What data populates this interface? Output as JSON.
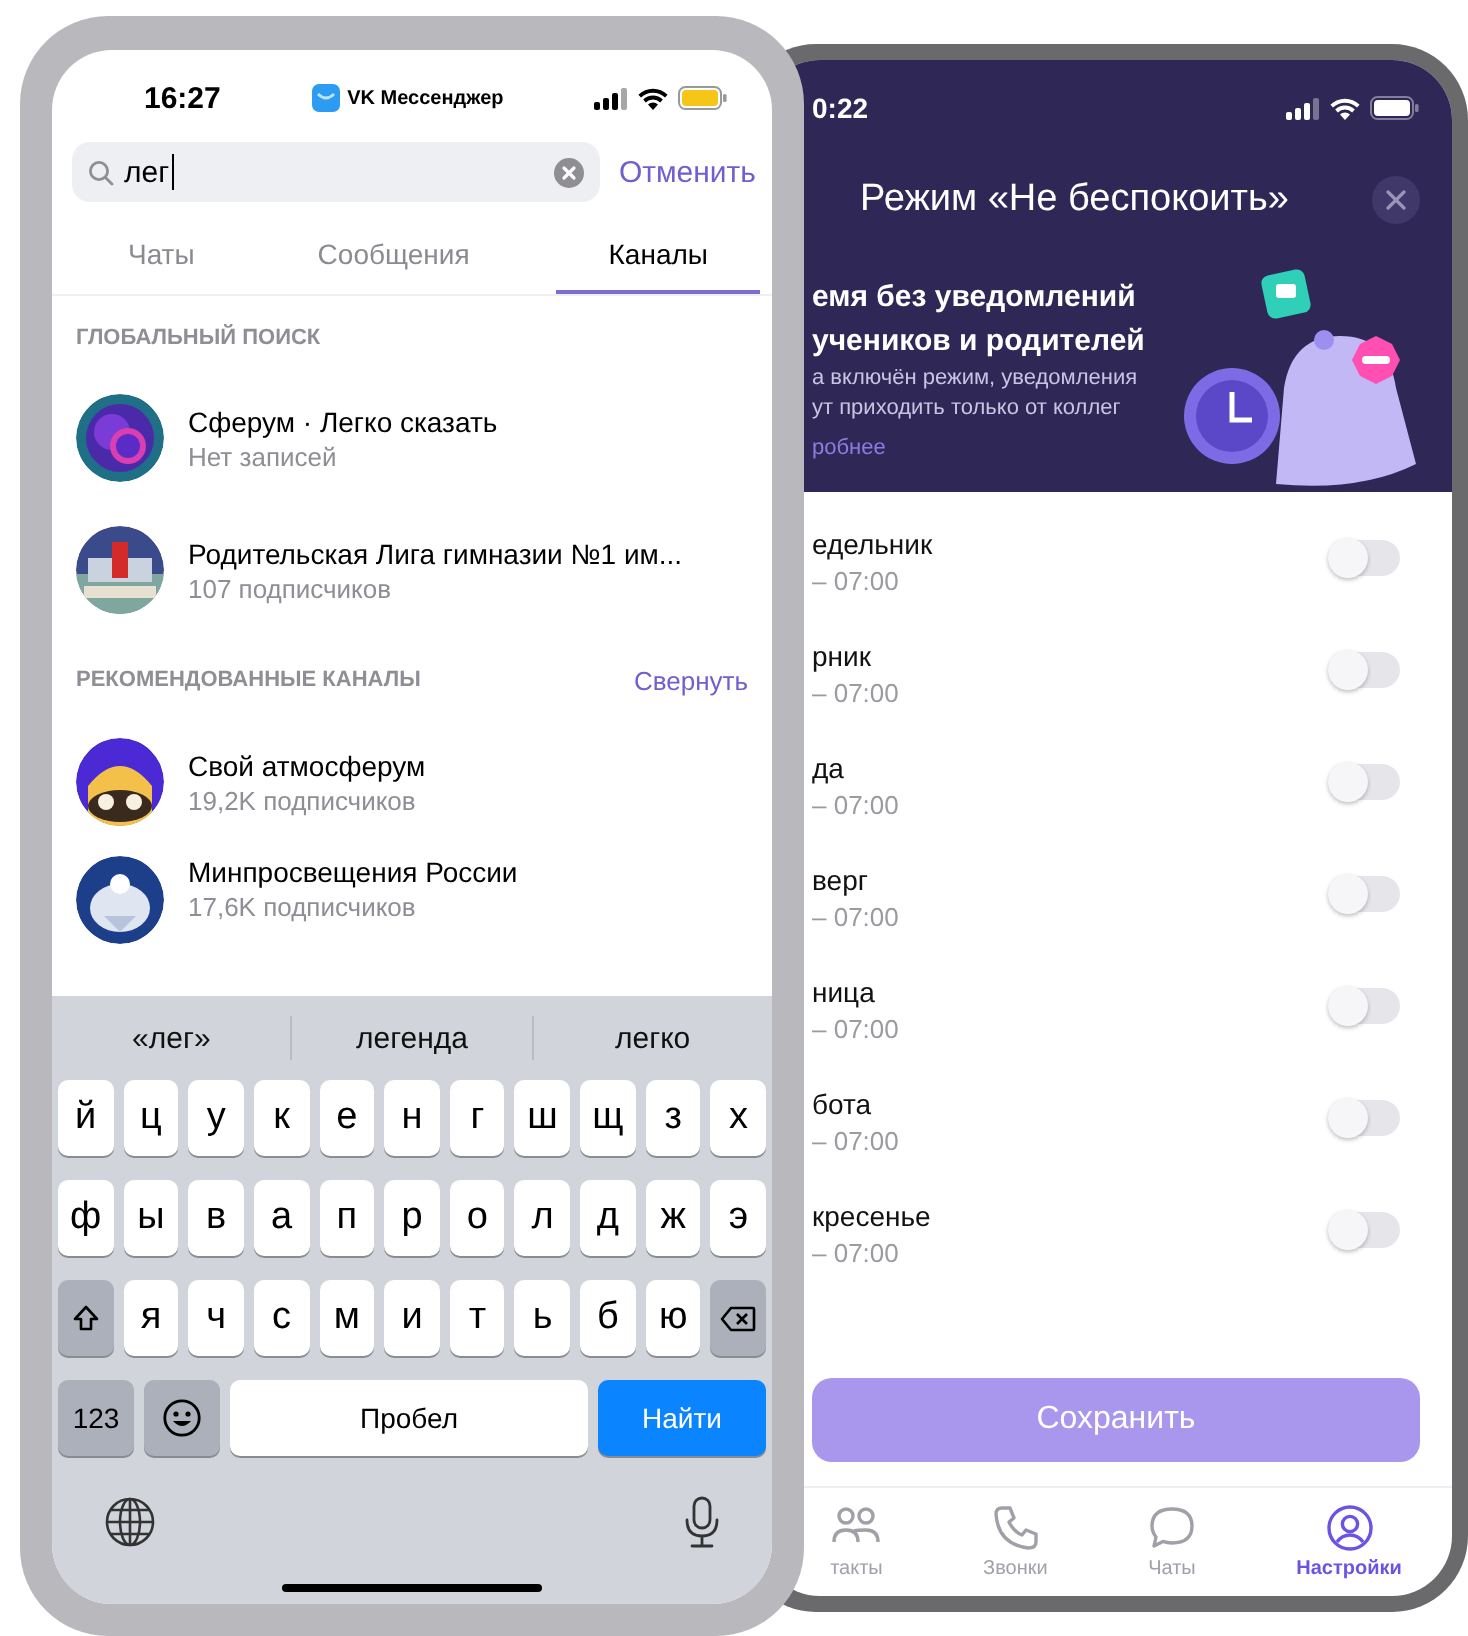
{
  "left_phone": {
    "status_bar": {
      "time": "16:27",
      "app": "VK Мессенджер"
    },
    "search": {
      "value": "лег",
      "cancel": "Отменить"
    },
    "tabs": [
      {
        "label": "Чаты",
        "selected": false
      },
      {
        "label": "Сообщения",
        "selected": false
      },
      {
        "label": "Каналы",
        "selected": true
      }
    ],
    "sections": [
      {
        "title": "ГЛОБАЛЬНЫЙ ПОИСК",
        "items": [
          {
            "title": "Сферум · Легко сказать",
            "subtitle": "Нет записей"
          },
          {
            "title": "Родительская Лига гимназии №1 им...",
            "subtitle": "107 подписчиков"
          }
        ]
      },
      {
        "title": "РЕКОМЕНДОВАННЫЕ КАНАЛЫ",
        "action": "Свернуть",
        "items": [
          {
            "title": "Свой атмосферум",
            "subtitle": "19,2K подписчиков"
          },
          {
            "title": "Минпросвещения России",
            "subtitle": "17,6K подписчиков"
          }
        ]
      }
    ],
    "keyboard": {
      "suggestions": [
        "«лег»",
        "легенда",
        "легко"
      ],
      "rows": [
        [
          {
            "kind": "letter",
            "label": "й"
          },
          {
            "kind": "letter",
            "label": "ц"
          },
          {
            "kind": "letter",
            "label": "у"
          },
          {
            "kind": "letter",
            "label": "к"
          },
          {
            "kind": "letter",
            "label": "е"
          },
          {
            "kind": "letter",
            "label": "н"
          },
          {
            "kind": "letter",
            "label": "г"
          },
          {
            "kind": "letter",
            "label": "ш"
          },
          {
            "kind": "letter",
            "label": "щ"
          },
          {
            "kind": "letter",
            "label": "з"
          },
          {
            "kind": "letter",
            "label": "х"
          }
        ],
        [
          {
            "kind": "letter",
            "label": "ф"
          },
          {
            "kind": "letter",
            "label": "ы"
          },
          {
            "kind": "letter",
            "label": "в"
          },
          {
            "kind": "letter",
            "label": "а"
          },
          {
            "kind": "letter",
            "label": "п"
          },
          {
            "kind": "letter",
            "label": "р"
          },
          {
            "kind": "letter",
            "label": "о"
          },
          {
            "kind": "letter",
            "label": "л"
          },
          {
            "kind": "letter",
            "label": "д"
          },
          {
            "kind": "letter",
            "label": "ж"
          },
          {
            "kind": "letter",
            "label": "э"
          }
        ],
        [
          {
            "kind": "shift"
          },
          {
            "kind": "letter",
            "label": "я"
          },
          {
            "kind": "letter",
            "label": "ч"
          },
          {
            "kind": "letter",
            "label": "с"
          },
          {
            "kind": "letter",
            "label": "м"
          },
          {
            "kind": "letter",
            "label": "и"
          },
          {
            "kind": "letter",
            "label": "т"
          },
          {
            "kind": "letter",
            "label": "ь"
          },
          {
            "kind": "letter",
            "label": "б"
          },
          {
            "kind": "letter",
            "label": "ю"
          },
          {
            "kind": "delete"
          }
        ]
      ],
      "numbers_key": "123",
      "space": "Пробел",
      "go": "Найти"
    }
  },
  "right_phone": {
    "status_bar": {
      "time": "0:22"
    },
    "title": "Режим «Не беспокоить»",
    "banner": {
      "heading_lines": [
        "емя без уведомлений",
        "учеников и родителей"
      ],
      "text_lines": [
        "а включён режим, уведомления",
        "ут приходить только от коллег"
      ],
      "link": "робнее"
    },
    "days": [
      {
        "name": "едельник",
        "time": "– 07:00",
        "on": false
      },
      {
        "name": "рник",
        "time": "– 07:00",
        "on": false
      },
      {
        "name": "да",
        "time": "– 07:00",
        "on": false
      },
      {
        "name": "верг",
        "time": "– 07:00",
        "on": false
      },
      {
        "name": "ница",
        "time": "– 07:00",
        "on": false
      },
      {
        "name": "бота",
        "time": "– 07:00",
        "on": false
      },
      {
        "name": "кресенье",
        "time": "– 07:00",
        "on": false
      }
    ],
    "save": "Сохранить",
    "nav": [
      {
        "label": "такты",
        "kind": "people",
        "selected": false
      },
      {
        "label": "Звонки",
        "kind": "phone",
        "selected": false
      },
      {
        "label": "Чаты",
        "kind": "chat",
        "selected": false
      },
      {
        "label": "Настройки",
        "kind": "profile",
        "selected": true
      }
    ]
  }
}
